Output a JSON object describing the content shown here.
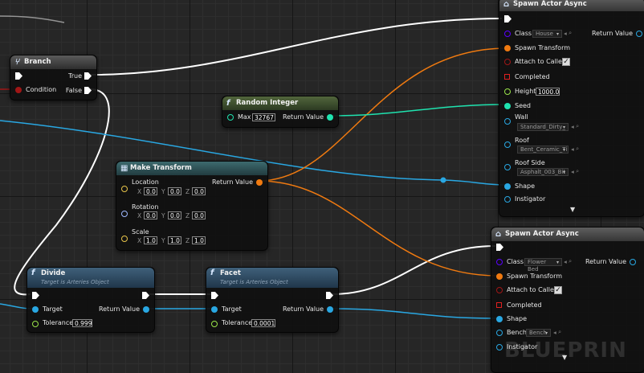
{
  "colors": {
    "exec": "#ffffff",
    "object": "#29a7e2",
    "struct": "#f07a10",
    "bool": "#a01616",
    "int": "#1fe3af",
    "vector": "#e7c44a",
    "rotator": "#9fb9ff",
    "class": "#5a00ff",
    "float": "#9ae54a"
  },
  "watermark": "BLUEPRIN",
  "branch": {
    "title": "Branch",
    "true_label": "True",
    "false_label": "False",
    "condition_label": "Condition"
  },
  "random_integer": {
    "title": "Random Integer",
    "max_label": "Max",
    "max_value": "32767",
    "return_label": "Return Value"
  },
  "make_transform": {
    "title": "Make Transform",
    "return_label": "Return Value",
    "location_label": "Location",
    "rotation_label": "Rotation",
    "scale_label": "Scale",
    "axis_x": "X",
    "axis_y": "Y",
    "axis_z": "Z",
    "location": {
      "x": "0.0",
      "y": "0.0",
      "z": "0.0"
    },
    "rotation": {
      "x": "0.0",
      "y": "0.0",
      "z": "0.0"
    },
    "scale": {
      "x": "1.0",
      "y": "1.0",
      "z": "1.0"
    }
  },
  "divide": {
    "title": "Divide",
    "subtitle": "Target is Arteries Object",
    "target_label": "Target",
    "return_label": "Return Value",
    "tolerance_label": "Tolerance",
    "tolerance_value": "0.999"
  },
  "facet": {
    "title": "Facet",
    "subtitle": "Target is Arteries Object",
    "target_label": "Target",
    "return_label": "Return Value",
    "tolerance_label": "Tolerance",
    "tolerance_value": "0.0001"
  },
  "spawn_house": {
    "title": "Spawn Actor Async",
    "class_label": "Class",
    "class_value": "House",
    "return_label": "Return Value",
    "spawn_transform_label": "Spawn Transform",
    "attach_label": "Attach to Caller",
    "completed_label": "Completed",
    "height_label": "Height",
    "height_value": "1000.0",
    "seed_label": "Seed",
    "wall_label": "Wall",
    "wall_value": "Standard_Dirty_",
    "roof_label": "Roof",
    "roof_value": "Bent_Ceramic_Ti",
    "roof_side_label": "Roof Side",
    "roof_side_value": "Asphalt_003_Bit",
    "shape_label": "Shape",
    "instigator_label": "Instigator",
    "attach_checked": true
  },
  "spawn_flower": {
    "title": "Spawn Actor Async",
    "class_label": "Class",
    "class_value": "Flower Bed",
    "return_label": "Return Value",
    "spawn_transform_label": "Spawn Transform",
    "attach_label": "Attach to Caller",
    "completed_label": "Completed",
    "shape_label": "Shape",
    "bench_label": "Bench",
    "bench_value": "Bench",
    "instigator_label": "Instigator",
    "attach_checked": true
  },
  "glyphs": {
    "function": "f",
    "check": "✓",
    "expand": "▼",
    "caret": "▾",
    "browse": "◂",
    "search": "⌕"
  }
}
